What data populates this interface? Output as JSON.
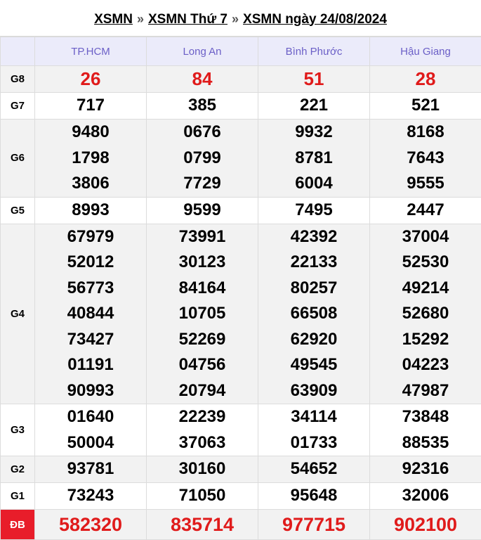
{
  "breadcrumb": {
    "items": [
      "XSMN",
      "XSMN Thứ 7",
      "XSMN ngày 24/08/2024"
    ],
    "separator": "»"
  },
  "provinces": [
    "TP.HCM",
    "Long An",
    "Bình Phước",
    "Hậu Giang"
  ],
  "colors": {
    "header_bg": "#ebebfa",
    "header_text": "#6b5fc7",
    "highlight_red": "#e01b1b",
    "db_label_bg": "#e81d2a",
    "shade_bg": "#f2f2f2"
  },
  "prizes": [
    {
      "label": "G8",
      "class": "g8",
      "values": [
        [
          "26"
        ],
        [
          "84"
        ],
        [
          "51"
        ],
        [
          "28"
        ]
      ]
    },
    {
      "label": "G7",
      "values": [
        [
          "717"
        ],
        [
          "385"
        ],
        [
          "221"
        ],
        [
          "521"
        ]
      ]
    },
    {
      "label": "G6",
      "values": [
        [
          "9480",
          "1798",
          "3806"
        ],
        [
          "0676",
          "0799",
          "7729"
        ],
        [
          "9932",
          "8781",
          "6004"
        ],
        [
          "8168",
          "7643",
          "9555"
        ]
      ]
    },
    {
      "label": "G5",
      "values": [
        [
          "8993"
        ],
        [
          "9599"
        ],
        [
          "7495"
        ],
        [
          "2447"
        ]
      ]
    },
    {
      "label": "G4",
      "values": [
        [
          "67979",
          "52012",
          "56773",
          "40844",
          "73427",
          "01191",
          "90993"
        ],
        [
          "73991",
          "30123",
          "84164",
          "10705",
          "52269",
          "04756",
          "20794"
        ],
        [
          "42392",
          "22133",
          "80257",
          "66508",
          "62920",
          "49545",
          "63909"
        ],
        [
          "37004",
          "52530",
          "49214",
          "52680",
          "15292",
          "04223",
          "47987"
        ]
      ]
    },
    {
      "label": "G3",
      "values": [
        [
          "01640",
          "50004"
        ],
        [
          "22239",
          "37063"
        ],
        [
          "34114",
          "01733"
        ],
        [
          "73848",
          "88535"
        ]
      ]
    },
    {
      "label": "G2",
      "values": [
        [
          "93781"
        ],
        [
          "30160"
        ],
        [
          "54652"
        ],
        [
          "92316"
        ]
      ]
    },
    {
      "label": "G1",
      "values": [
        [
          "73243"
        ],
        [
          "71050"
        ],
        [
          "95648"
        ],
        [
          "32006"
        ]
      ]
    },
    {
      "label": "ĐB",
      "class": "db",
      "values": [
        [
          "582320"
        ],
        [
          "835714"
        ],
        [
          "977715"
        ],
        [
          "902100"
        ]
      ]
    }
  ]
}
